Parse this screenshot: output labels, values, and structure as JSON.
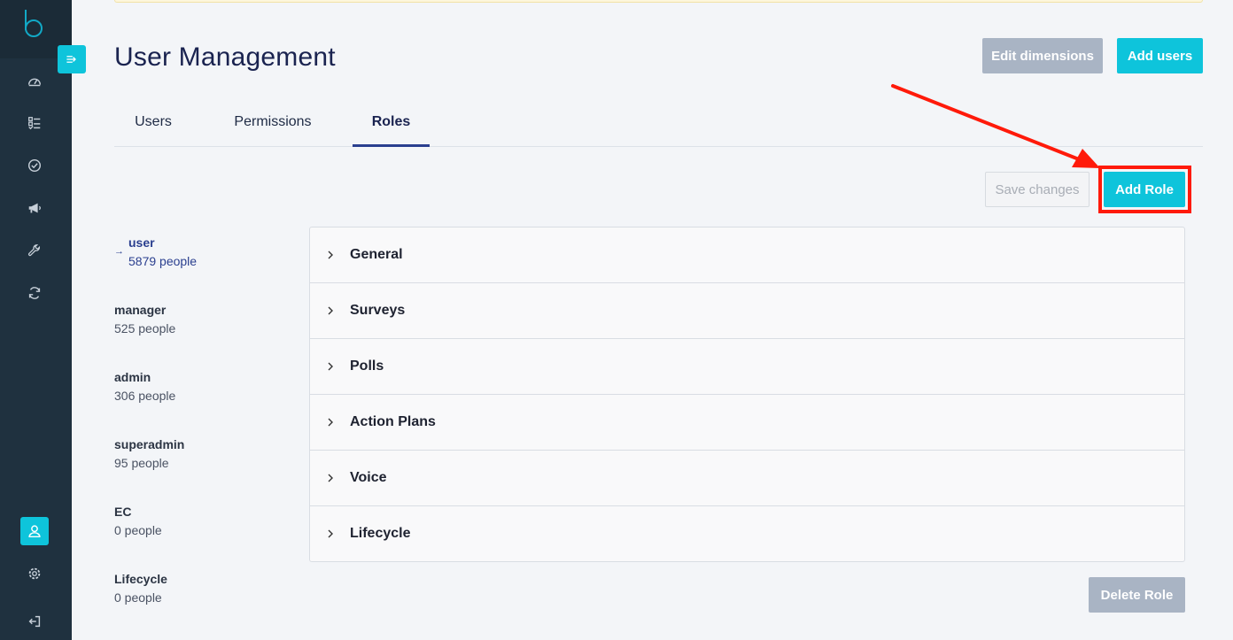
{
  "header": {
    "title": "User Management",
    "edit_dimensions_label": "Edit dimensions",
    "add_users_label": "Add users"
  },
  "tabs": [
    {
      "label": "Users"
    },
    {
      "label": "Permissions"
    },
    {
      "label": "Roles",
      "active": true
    }
  ],
  "toolbar": {
    "save_changes_label": "Save changes",
    "add_role_label": "Add Role"
  },
  "roles": [
    {
      "name": "user",
      "count": "5879 people",
      "active": true
    },
    {
      "name": "manager",
      "count": "525 people"
    },
    {
      "name": "admin",
      "count": "306 people"
    },
    {
      "name": "superadmin",
      "count": "95 people"
    },
    {
      "name": "EC",
      "count": "0 people"
    },
    {
      "name": "Lifecycle",
      "count": "0 people"
    }
  ],
  "permission_groups": [
    {
      "label": "General"
    },
    {
      "label": "Surveys"
    },
    {
      "label": "Polls"
    },
    {
      "label": "Action Plans"
    },
    {
      "label": "Voice"
    },
    {
      "label": "Lifecycle"
    }
  ],
  "footer": {
    "delete_role_label": "Delete Role"
  },
  "sidebar": {
    "icons": [
      "dashboard-icon",
      "checklist-icon",
      "check-circle-icon",
      "megaphone-icon",
      "wrench-icon",
      "sync-icon",
      "user-icon",
      "gear-icon",
      "logout-icon"
    ],
    "active": "user-icon"
  },
  "colors": {
    "accent": "#0ec4db",
    "sidebar": "#1f313f",
    "annotation": "#ff1a0a",
    "tab_indicator": "#2a3f8f"
  }
}
